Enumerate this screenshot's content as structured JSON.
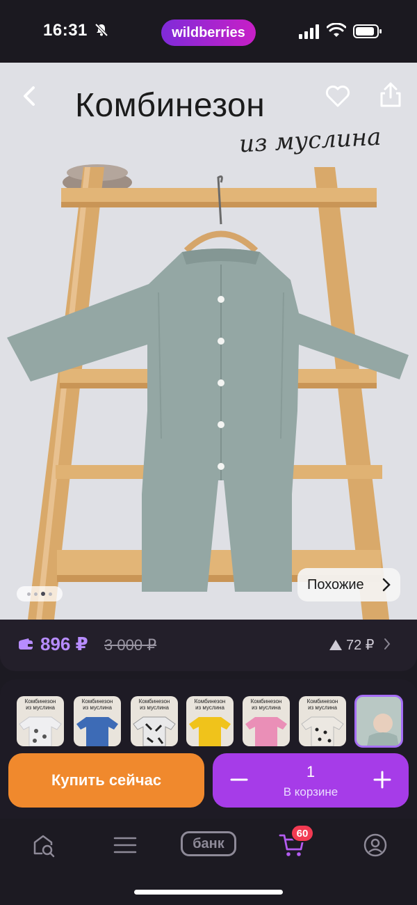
{
  "status_bar": {
    "time": "16:31",
    "brand": "wildberries",
    "icons": [
      "bell-off-icon",
      "signal-icon",
      "wifi-icon",
      "battery-icon"
    ]
  },
  "hero": {
    "title": "Комбинезон",
    "subtitle": "из муслина",
    "similar_label": "Похожие",
    "slide_count": 4,
    "active_slide": 3
  },
  "price": {
    "current": "896 ₽",
    "old": "3 000 ₽",
    "rating": "72 ₽"
  },
  "thumbnails": [
    {
      "line1": "Комбинезон",
      "line2": "из муслина",
      "color": "#efeff1"
    },
    {
      "line1": "Комбинезон",
      "line2": "из муслина",
      "color": "#3d6bb6"
    },
    {
      "line1": "Комбинезон",
      "line2": "из муслина",
      "color": "#e9e9ea"
    },
    {
      "line1": "Комбинезон",
      "line2": "из муслина",
      "color": "#f0c31b"
    },
    {
      "line1": "Комбинезон",
      "line2": "из муслина",
      "color": "#ea8fb7"
    },
    {
      "line1": "Комбинезон",
      "line2": "из муслина",
      "color": "#ece8e2"
    },
    {
      "line1": "",
      "line2": "",
      "color": "#b9c8c4"
    }
  ],
  "actions": {
    "buy_label": "Купить сейчас",
    "quantity": "1",
    "in_cart_label": "В корзине"
  },
  "nav": {
    "bank_label": "банк",
    "cart_badge": "60"
  },
  "colors": {
    "background": "#1c1a22",
    "accent_purple": "#a63ce8",
    "buy_orange": "#f0892d",
    "price_purple": "#b78cff",
    "badge_red": "#f23a52"
  }
}
